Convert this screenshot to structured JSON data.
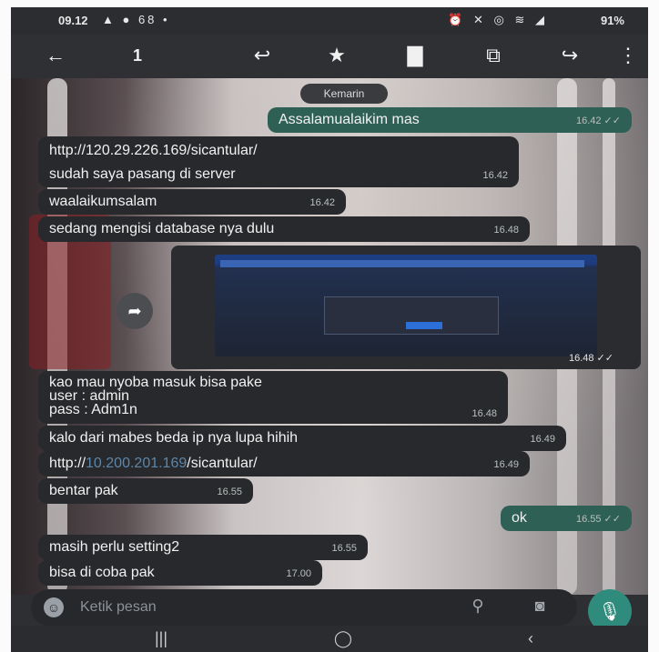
{
  "status_bar": {
    "time": "09.12",
    "notification_count": "68",
    "battery": "91%"
  },
  "action_bar": {
    "selected_count": "1"
  },
  "chat": {
    "date_chip": "Kemarin",
    "messages": [
      {
        "dir": "out",
        "text": "Assalamualaikim mas",
        "time": "16.42"
      },
      {
        "dir": "in",
        "lines": [
          "http://120.29.226.169/sicantular/",
          "sudah saya pasang di server"
        ],
        "time": "16.42"
      },
      {
        "dir": "in",
        "text": "waalaikumsalam",
        "time": "16.42"
      },
      {
        "dir": "in",
        "text": "sedang mengisi database nya dulu",
        "time": "16.48"
      },
      {
        "dir": "out",
        "type": "image",
        "time": "16.48"
      },
      {
        "dir": "in",
        "lines": [
          "kao mau nyoba masuk bisa pake",
          "user : admin",
          "pass : Adm1n"
        ],
        "time": "16.48"
      },
      {
        "dir": "in",
        "text": "kalo dari mabes beda ip nya lupa hihih",
        "time": "16.49"
      },
      {
        "dir": "in",
        "link_prefix": "http://",
        "link_host": "10.200.201.169",
        "link_path": "/sicantular/",
        "time": "16.49"
      },
      {
        "dir": "in",
        "text": "bentar pak",
        "time": "16.55"
      },
      {
        "dir": "out",
        "text": "ok",
        "time": "16.55"
      },
      {
        "dir": "in",
        "text": "masih perlu setting2",
        "time": "16.55"
      },
      {
        "dir": "in",
        "text": "bisa di coba pak",
        "time": "17.00"
      }
    ]
  },
  "composer": {
    "placeholder": "Ketik pesan"
  },
  "icons": {
    "back": "arrow-left-icon",
    "reply": "reply-icon",
    "star": "star-icon",
    "delete": "trash-icon",
    "copy": "copy-icon",
    "forward": "forward-icon",
    "more": "more-vert-icon",
    "emoji": "emoji-icon",
    "attach": "paperclip-icon",
    "camera": "camera-icon",
    "mic": "mic-icon"
  }
}
